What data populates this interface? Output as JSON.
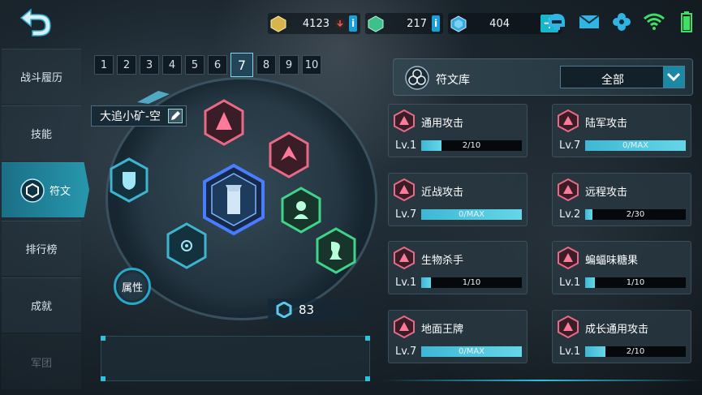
{
  "resources": [
    {
      "icon": "gold-cube-icon",
      "value": "4123",
      "has_info": true
    },
    {
      "icon": "green-gem-icon",
      "value": "217",
      "has_info": true
    },
    {
      "icon": "blue-crystal-icon",
      "value": "404",
      "has_plus": true
    }
  ],
  "top_icons": [
    "helmet-icon",
    "mail-icon",
    "settings-flower-icon",
    "wifi-icon",
    "battery-icon"
  ],
  "sidebar": {
    "items": [
      {
        "label": "战斗履历",
        "active": false
      },
      {
        "label": "技能",
        "active": false
      },
      {
        "label": "符文",
        "active": true
      },
      {
        "label": "排行榜",
        "active": false
      },
      {
        "label": "成就",
        "active": false
      },
      {
        "label": "军团",
        "active": false
      }
    ]
  },
  "pages": {
    "tabs": [
      "1",
      "2",
      "3",
      "4",
      "5",
      "6",
      "7",
      "8",
      "9",
      "10"
    ],
    "active": "7"
  },
  "loadout": {
    "name": "大追小矿-空",
    "attr_label": "属性",
    "points": "83"
  },
  "library": {
    "title": "符文库",
    "filter_value": "全部",
    "cards": [
      {
        "name": "通用攻击",
        "level": "Lv.1",
        "progress_text": "2/10",
        "progress": 0.2,
        "icon_color": "red"
      },
      {
        "name": "陆军攻击",
        "level": "Lv.7",
        "progress_text": "0/MAX",
        "progress": 1.0,
        "icon_color": "red"
      },
      {
        "name": "近战攻击",
        "level": "Lv.7",
        "progress_text": "0/MAX",
        "progress": 1.0,
        "icon_color": "red"
      },
      {
        "name": "远程攻击",
        "level": "Lv.2",
        "progress_text": "2/30",
        "progress": 0.067,
        "icon_color": "red"
      },
      {
        "name": "生物杀手",
        "level": "Lv.1",
        "progress_text": "1/10",
        "progress": 0.1,
        "icon_color": "red"
      },
      {
        "name": "蝙蝠味糖果",
        "level": "Lv.1",
        "progress_text": "1/10",
        "progress": 0.1,
        "icon_color": "red"
      },
      {
        "name": "地面王牌",
        "level": "Lv.7",
        "progress_text": "0/MAX",
        "progress": 1.0,
        "icon_color": "red"
      },
      {
        "name": "成长通用攻击",
        "level": "Lv.1",
        "progress_text": "2/10",
        "progress": 0.2,
        "icon_color": "red"
      }
    ]
  }
}
